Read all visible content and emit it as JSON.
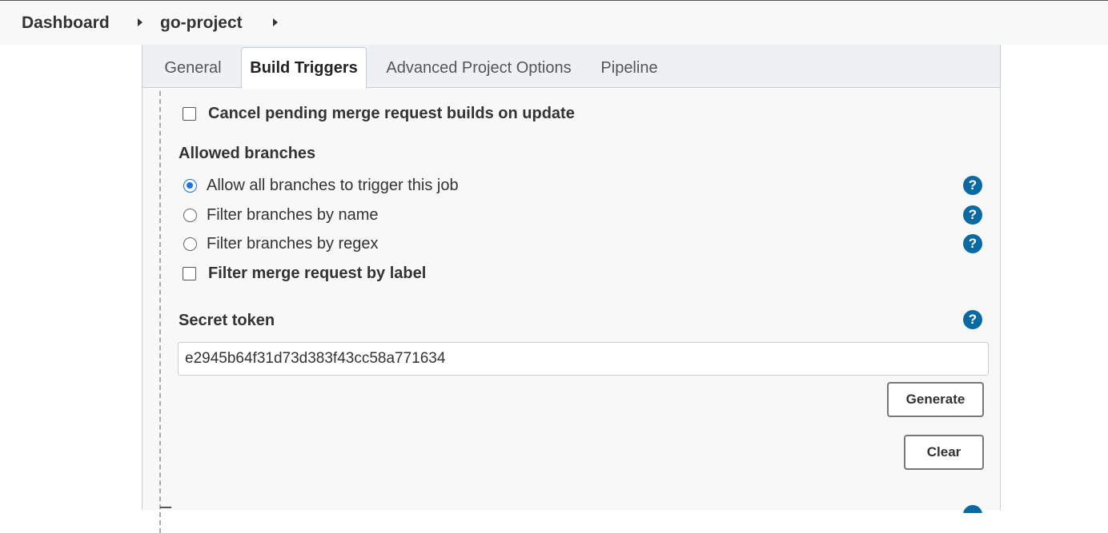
{
  "breadcrumb": {
    "items": [
      "Dashboard",
      "go-project"
    ]
  },
  "tabs": [
    {
      "label": "General",
      "active": false
    },
    {
      "label": "Build Triggers",
      "active": true
    },
    {
      "label": "Advanced Project Options",
      "active": false
    },
    {
      "label": "Pipeline",
      "active": false
    }
  ],
  "form": {
    "cancel_pending": {
      "label": "Cancel pending merge request builds on update",
      "checked": false
    },
    "allowed_branches": {
      "title": "Allowed branches",
      "options": [
        {
          "label": "Allow all branches to trigger this job",
          "selected": true
        },
        {
          "label": "Filter branches by name",
          "selected": false
        },
        {
          "label": "Filter branches by regex",
          "selected": false
        }
      ]
    },
    "filter_label": {
      "label": "Filter merge request by label",
      "checked": false
    },
    "secret_token": {
      "title": "Secret token",
      "value": "e2945b64f31d73d383f43cc58a771634"
    },
    "generate_label": "Generate",
    "clear_label": "Clear"
  },
  "icons": {
    "help": "question-mark-icon",
    "help_glyph": "?",
    "breadcrumb_arrow": "caret-right-icon"
  },
  "colors": {
    "accent": "#1a73e8",
    "help_icon": "#0b6aa2"
  }
}
